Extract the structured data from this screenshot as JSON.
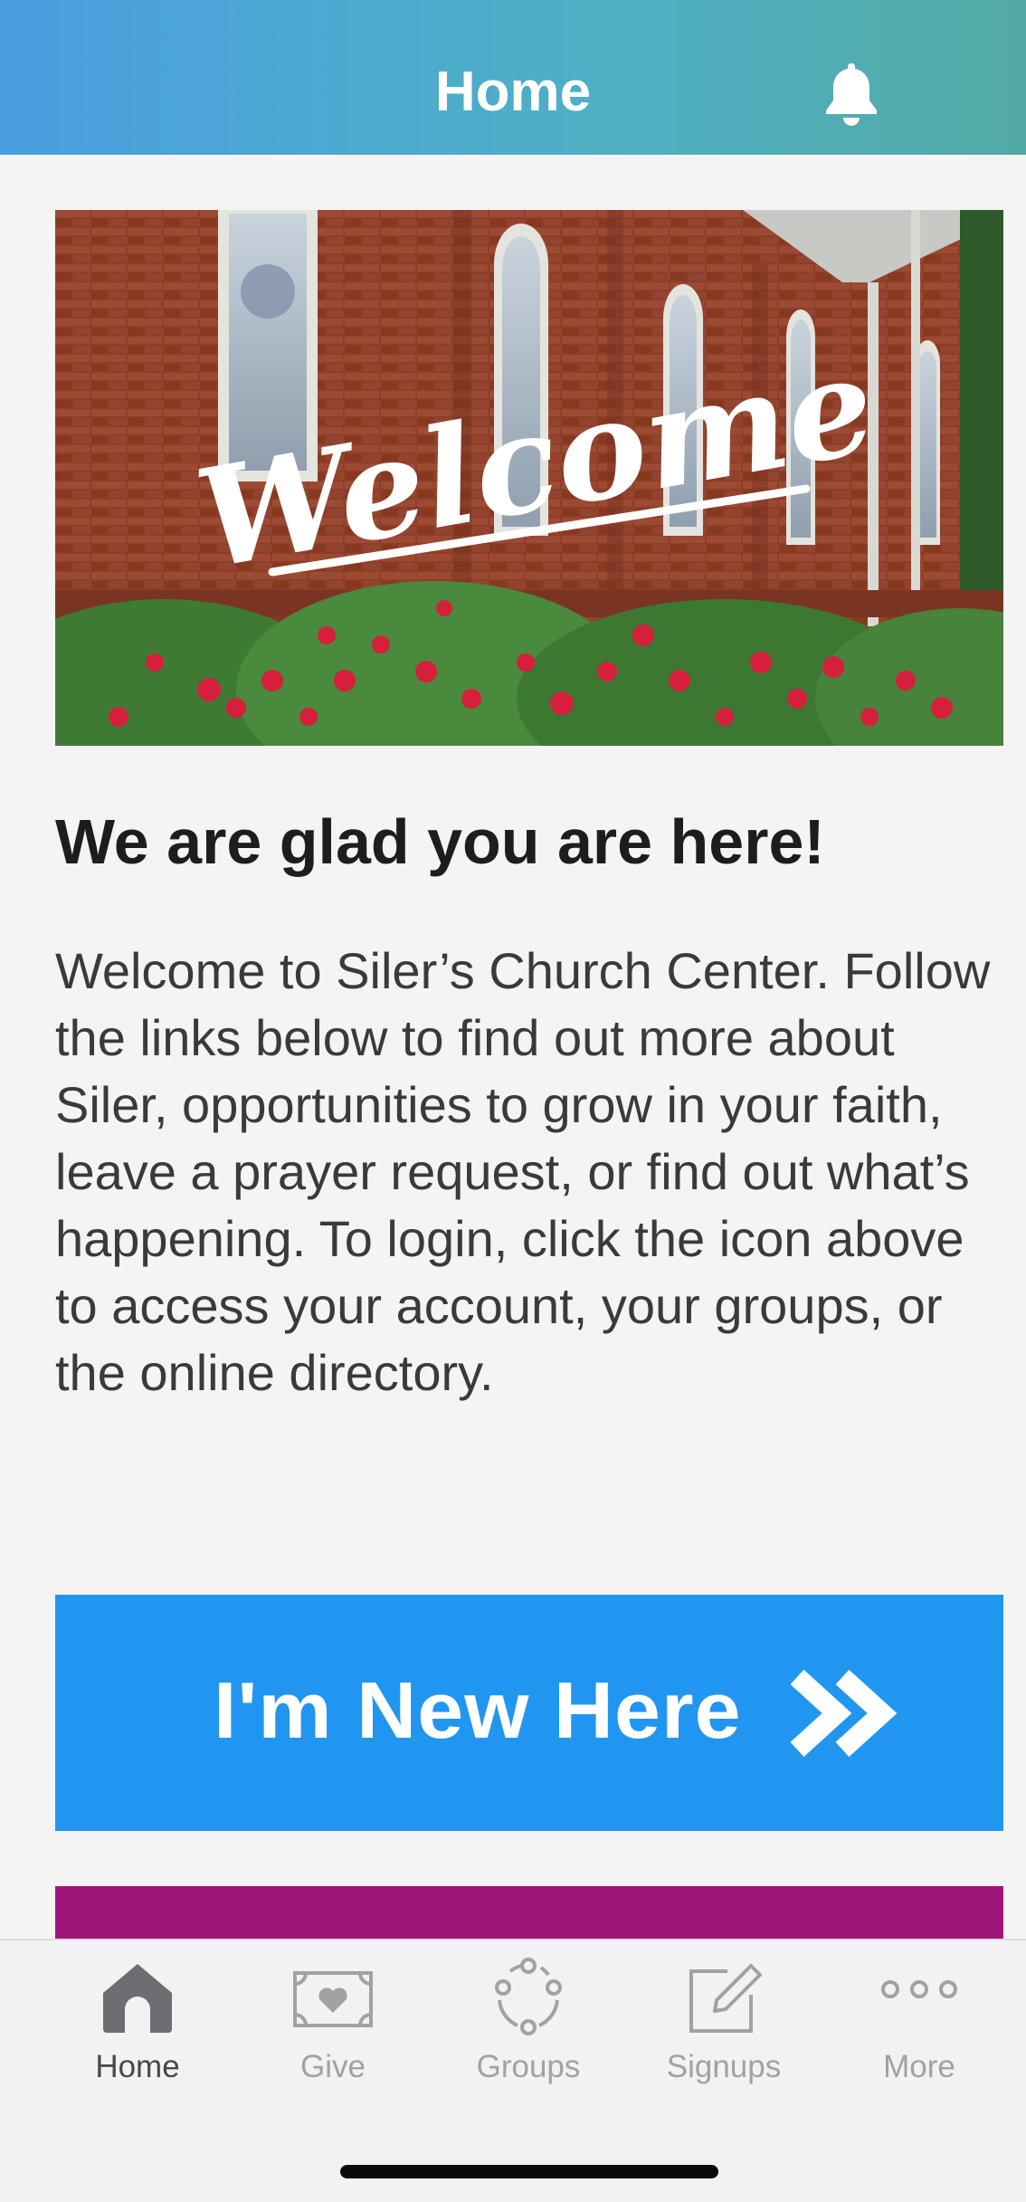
{
  "header": {
    "title": "Home",
    "notifications_icon": "bell-icon",
    "gradient": [
      "#4a9fe0",
      "#53aaa4"
    ]
  },
  "banner": {
    "script_text": "Welcome",
    "description": "Photo of a brick church with arched stained-glass windows and red rose bushes"
  },
  "content": {
    "heading": "We are glad you are here!",
    "body": "Welcome to Siler’s Church Center. Follow the links below to find out more about Siler, opportunities to grow in your faith, leave a prayer request, or find out what’s happening. To login, click the icon above to access your account, your groups, or the online directory."
  },
  "cards": {
    "new_here": {
      "label": "I'm New Here",
      "icon": "double-chevron-right-icon",
      "color": "#2196f0"
    },
    "next_card_color": "#a0157a"
  },
  "tabbar": {
    "active": "Home",
    "items": [
      {
        "label": "Home",
        "icon": "home-icon"
      },
      {
        "label": "Give",
        "icon": "give-money-icon"
      },
      {
        "label": "Groups",
        "icon": "groups-icon"
      },
      {
        "label": "Signups",
        "icon": "signups-edit-icon"
      },
      {
        "label": "More",
        "icon": "more-dots-icon"
      }
    ]
  },
  "colors": {
    "background": "#f4f4f5",
    "active_tab": "#48484a",
    "inactive_tab": "#a1a1a6"
  }
}
